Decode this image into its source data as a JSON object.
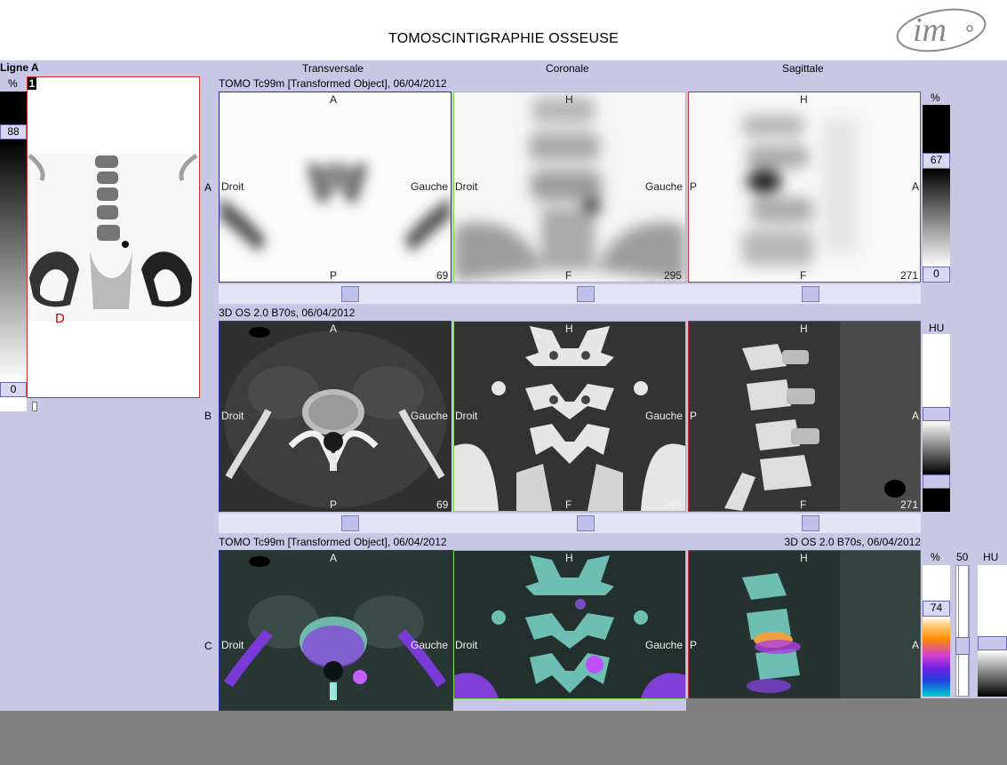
{
  "header": {
    "title": "TOMOSCINTIGRAPHIE OSSEUSE",
    "logo_text": "im"
  },
  "left_panel": {
    "title": "Ligne A",
    "percent_label": "%",
    "value_top": "88",
    "value_bottom": "0",
    "badge": "1",
    "marker": "D"
  },
  "columns": {
    "transversale": "Transversale",
    "coronale": "Coronale",
    "sagittale": "Sagittale"
  },
  "rows": {
    "a": "A",
    "b": "B",
    "c": "C"
  },
  "row_a": {
    "caption": "TOMO Tc99m [Transformed Object], 06/04/2012",
    "scale_label": "%",
    "scale_top": "67",
    "scale_bottom": "0"
  },
  "row_b": {
    "caption": "3D OS  2.0  B70s, 06/04/2012",
    "scale_label": "HU"
  },
  "row_c": {
    "caption_left": "TOMO Tc99m [Transformed Object], 06/04/2012",
    "caption_right": "3D OS  2.0  B70s, 06/04/2012",
    "percent_label": "%",
    "fifty_label": "50",
    "hu_label": "HU",
    "scale_value": "74"
  },
  "orient": {
    "ant": "A",
    "post": "P",
    "droit": "Droit",
    "gauche": "Gauche",
    "head": "H",
    "foot": "F"
  },
  "slices": {
    "trans": "69",
    "cor": "295",
    "sag": "271"
  },
  "colors": {
    "background": "#c8c8e6",
    "transversal_border": "#2a2ab0",
    "coronal_border": "#7fdc4a",
    "sagittal_border": "#d03030"
  }
}
